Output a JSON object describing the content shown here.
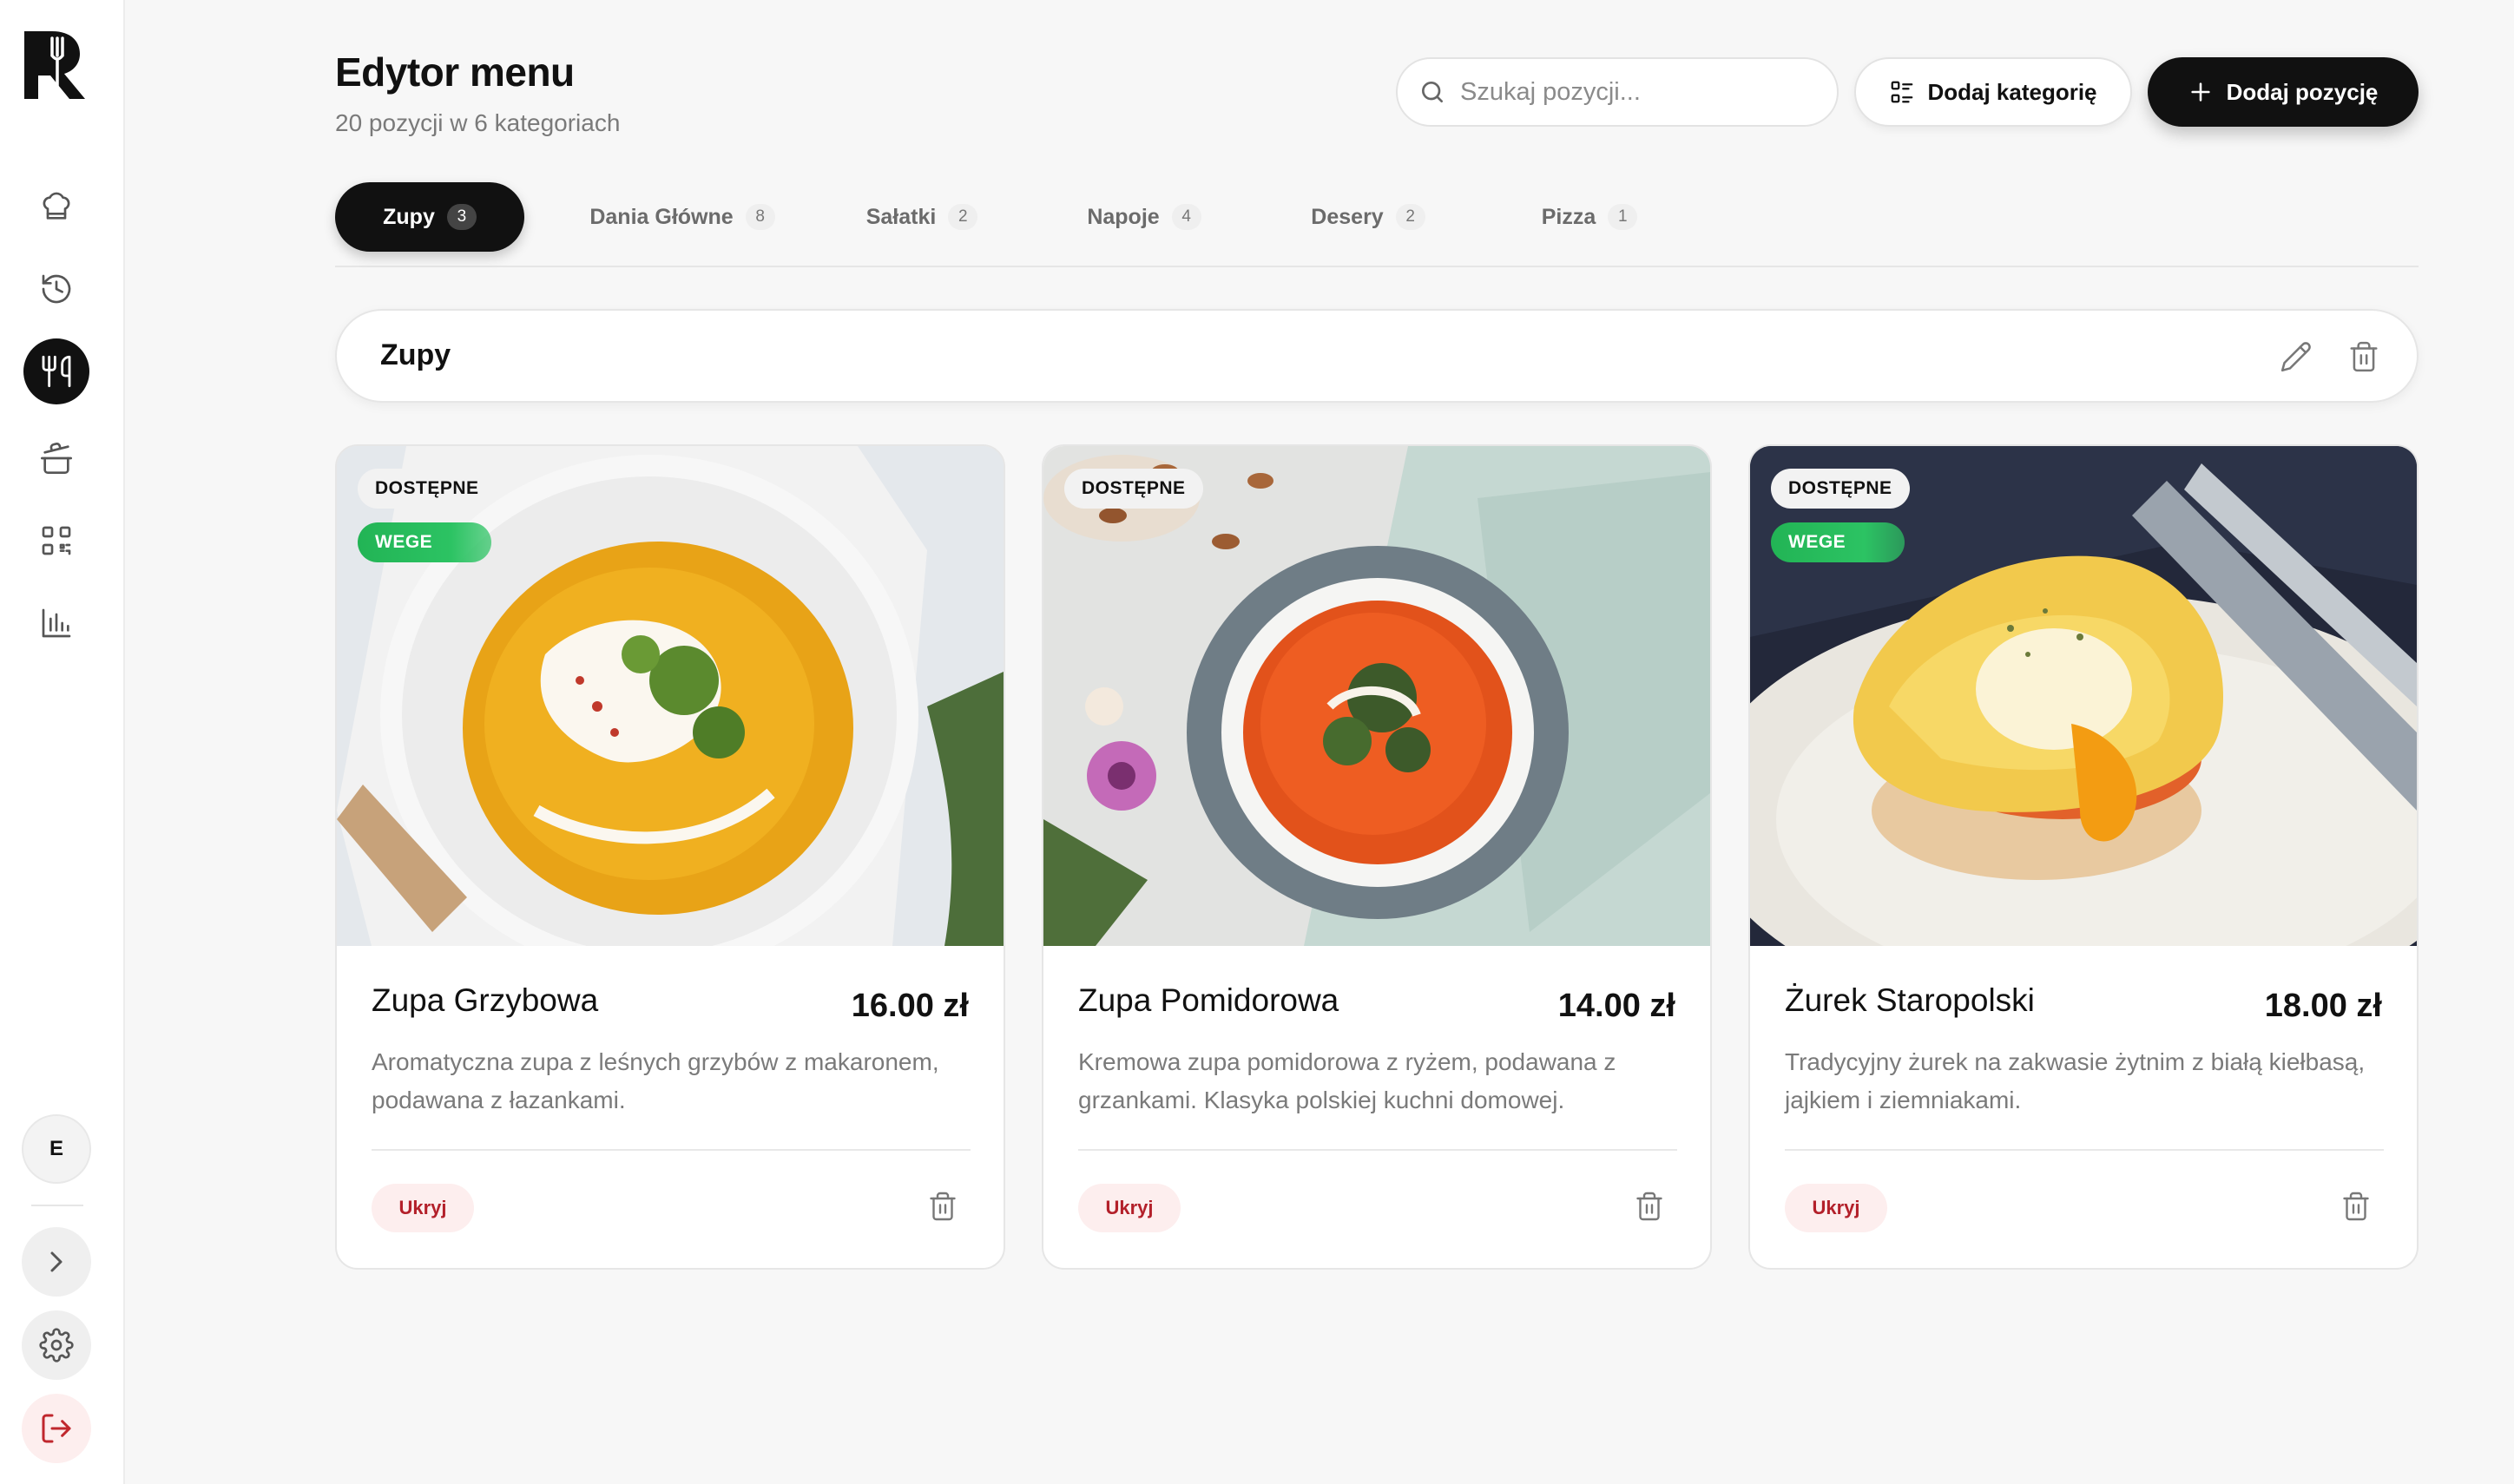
{
  "header": {
    "title": "Edytor menu",
    "subtitle": "20 pozycji w 6 kategoriach"
  },
  "search": {
    "placeholder": "Szukaj pozycji...",
    "value": ""
  },
  "toolbar": {
    "add_category_label": "Dodaj kategorię",
    "add_item_label": "Dodaj pozycję"
  },
  "sidebar": {
    "user_initial": "E",
    "items": [
      {
        "name": "chef-hat-icon",
        "active": false
      },
      {
        "name": "history-icon",
        "active": false
      },
      {
        "name": "utensils-icon",
        "active": true
      },
      {
        "name": "cooking-pot-icon",
        "active": false
      },
      {
        "name": "qr-code-icon",
        "active": false
      },
      {
        "name": "bar-chart-icon",
        "active": false
      }
    ]
  },
  "tabs": [
    {
      "label": "Zupy",
      "count": "3",
      "active": true
    },
    {
      "label": "Dania Główne",
      "count": "8",
      "active": false
    },
    {
      "label": "Sałatki",
      "count": "2",
      "active": false
    },
    {
      "label": "Napoje",
      "count": "4",
      "active": false
    },
    {
      "label": "Desery",
      "count": "2",
      "active": false
    },
    {
      "label": "Pizza",
      "count": "1",
      "active": false
    }
  ],
  "category": {
    "title": "Zupy"
  },
  "items": [
    {
      "name": "Zupa Grzybowa",
      "price": "16.00 zł",
      "description": "Aromatyczna zupa z leśnych grzybów z makaronem, podawana z łazankami.",
      "status_badge": "DOSTĘPNE",
      "diet_badge": "WEGE",
      "hide_label": "Ukryj",
      "image": "pumpkin-soup-photo"
    },
    {
      "name": "Zupa Pomidorowa",
      "price": "14.00 zł",
      "description": "Kremowa zupa pomidorowa z ryżem, podawana z grzankami. Klasyka polskiej kuchni domowej.",
      "status_badge": "DOSTĘPNE",
      "diet_badge": "",
      "hide_label": "Ukryj",
      "image": "tomato-soup-photo"
    },
    {
      "name": "Żurek Staropolski",
      "price": "18.00 zł",
      "description": "Tradycyjny żurek na zakwasie żytnim z białą kiełbasą, jajkiem i ziemniakami.",
      "status_badge": "DOSTĘPNE",
      "diet_badge": "WEGE",
      "hide_label": "Ukryj",
      "image": "eggs-benedict-photo"
    }
  ],
  "colors": {
    "accent": "#111111",
    "vege": "#2cc363",
    "hide_bg": "#fdeeee",
    "hide_text": "#b3202a",
    "background": "#f7f7f7"
  }
}
